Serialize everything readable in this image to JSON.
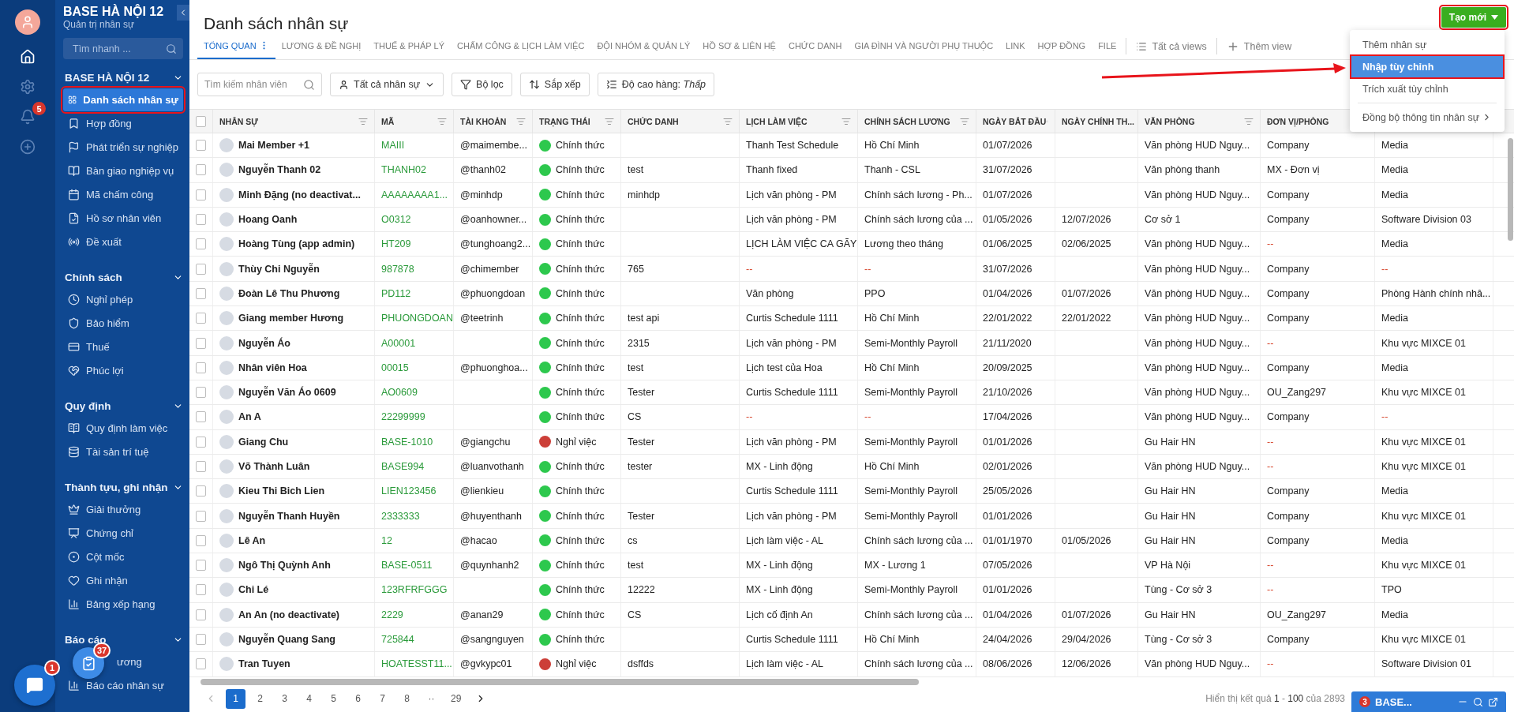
{
  "sidebar": {
    "org_name": "BASE HÀ NỘI 12",
    "org_subtitle": "Quản trị nhân sự",
    "search": {
      "placeholder": "Tìm nhanh ..."
    },
    "notifications_badge": "5",
    "sections": [
      {
        "title": "BASE HÀ NỘI 12",
        "expanded": true,
        "items": [
          {
            "label": "Danh sách nhân sự",
            "selected": true
          },
          {
            "label": "Hợp đồng",
            "selected": false
          },
          {
            "label": "Phát triển sự nghiệp",
            "selected": false
          },
          {
            "label": "Bàn giao nghiệp vụ",
            "selected": false
          },
          {
            "label": "Mã chấm công",
            "selected": false
          },
          {
            "label": "Hồ sơ nhân viên",
            "selected": false
          },
          {
            "label": "Đề xuất",
            "selected": false
          }
        ]
      },
      {
        "title": "Chính sách",
        "expanded": true,
        "items": [
          {
            "label": "Nghỉ phép",
            "selected": false
          },
          {
            "label": "Bảo hiểm",
            "selected": false
          },
          {
            "label": "Thuế",
            "selected": false
          },
          {
            "label": "Phúc lợi",
            "selected": false
          }
        ]
      },
      {
        "title": "Quy định",
        "expanded": true,
        "items": [
          {
            "label": "Quy định làm việc",
            "selected": false
          },
          {
            "label": "Tài sản trí tuệ",
            "selected": false
          }
        ]
      },
      {
        "title": "Thành tựu, ghi nhận",
        "expanded": true,
        "items": [
          {
            "label": "Giải thưởng",
            "selected": false
          },
          {
            "label": "Chứng chỉ",
            "selected": false
          },
          {
            "label": "Cột mốc",
            "selected": false
          },
          {
            "label": "Ghi nhận",
            "selected": false
          },
          {
            "label": "Bảng xếp hạng",
            "selected": false
          }
        ]
      },
      {
        "title": "Báo cáo",
        "expanded": true,
        "items": [
          {
            "label": "ương",
            "selected": false
          },
          {
            "label": "Báo cáo nhân sự",
            "selected": false
          }
        ]
      }
    ]
  },
  "floating": {
    "chat_badge": "1",
    "tasks_badge": "37"
  },
  "page": {
    "title": "Danh sách nhân sự",
    "create_button": "Tạo mới"
  },
  "tabs": [
    {
      "label": "TỔNG QUAN",
      "selected": true
    },
    {
      "label": "LƯƠNG & ĐỀ NGHỊ",
      "selected": false
    },
    {
      "label": "THUẾ & PHÁP LÝ",
      "selected": false
    },
    {
      "label": "CHẤM CÔNG & LỊCH LÀM VIỆC",
      "selected": false
    },
    {
      "label": "ĐỘI NHÓM & QUẢN LÝ",
      "selected": false
    },
    {
      "label": "HỒ SƠ & LIÊN HỆ",
      "selected": false
    },
    {
      "label": "CHỨC DANH",
      "selected": false
    },
    {
      "label": "GIA ĐÌNH VÀ NGƯỜI PHỤ THUỘC",
      "selected": false
    },
    {
      "label": "LINK",
      "selected": false
    },
    {
      "label": "HỢP ĐỒNG",
      "selected": false
    },
    {
      "label": "FILE",
      "selected": false
    }
  ],
  "view_actions": {
    "all_views": "Tất cả views",
    "add_view": "Thêm view"
  },
  "toolbar": {
    "search": {
      "placeholder": "Tìm kiếm nhân viên"
    },
    "scope": "Tất cả nhân sự",
    "filter": "Bộ lọc",
    "sort": "Sắp xếp",
    "row_height": "Độ cao hàng: *Thấp*"
  },
  "create_menu": {
    "items": [
      {
        "label": "Thêm nhân sự",
        "selected": false
      },
      {
        "label": "Nhập tùy chỉnh",
        "selected": true
      },
      {
        "label": "Trích xuất tùy chỉnh",
        "selected": false
      },
      {
        "label": "Đồng bộ thông tin nhân sự",
        "selected": false
      }
    ]
  },
  "table": {
    "select_all_checked": false,
    "columns": [
      "NHÂN SỰ",
      "MÃ",
      "TÀI KHOẢN",
      "TRẠNG THÁI",
      "CHỨC DANH",
      "LỊCH LÀM VIỆC",
      "CHÍNH SÁCH LƯƠNG",
      "NGÀY BẮT ĐẦU",
      "NGÀY CHÍNH TH...",
      "VĂN PHÒNG",
      "ĐƠN VỊ/PHÒNG"
    ],
    "rows": [
      {
        "checked": false,
        "cells": [
          "Mai Member +1",
          "MAIII",
          "@maimembe...",
          {
            "text": "Chính thức",
            "color": "#2dc84d"
          },
          "",
          "Thanh Test Schedule",
          "Hồ Chí Minh",
          "01/07/2026",
          "",
          "Văn phòng HUD Nguy...",
          "Company",
          "Media"
        ]
      },
      {
        "checked": false,
        "cells": [
          "Nguyễn Thanh 02",
          "THANH02",
          "@thanh02",
          {
            "text": "Chính thức",
            "color": "#2dc84d"
          },
          "test",
          "Thanh fixed",
          "Thanh - CSL",
          "31/07/2026",
          "",
          "Văn phòng thanh",
          "MX - Đơn vị",
          "Media"
        ]
      },
      {
        "checked": false,
        "cells": [
          "Minh Đặng (no deactivat...",
          "AAAAAAAA1...",
          "@minhdp",
          {
            "text": "Chính thức",
            "color": "#2dc84d"
          },
          "minhdp",
          "Lịch văn phòng - PM",
          "Chính sách lương - Ph...",
          "01/07/2026",
          "",
          "Văn phòng HUD Nguy...",
          "Company",
          "Media"
        ]
      },
      {
        "checked": false,
        "cells": [
          "Hoang Oanh",
          "O0312",
          "@oanhowner...",
          {
            "text": "Chính thức",
            "color": "#2dc84d"
          },
          "",
          "Lịch văn phòng - PM",
          "Chính sách lương của ...",
          "01/05/2026",
          "12/07/2026",
          "Cơ sở 1",
          "Company",
          "Software Division 03"
        ]
      },
      {
        "checked": false,
        "cells": [
          "Hoàng Tùng (app admin)",
          "HT209",
          "@tunghoang2...",
          {
            "text": "Chính thức",
            "color": "#2dc84d"
          },
          "",
          "LỊCH LÀM VIỆC CA GÃY",
          "Lương theo tháng",
          "01/06/2025",
          "02/06/2025",
          "Văn phòng HUD Nguy...",
          {
            "text": "--",
            "kind": "dash"
          },
          "Media"
        ]
      },
      {
        "checked": false,
        "cells": [
          "Thùy Chi Nguyễn",
          "987878",
          "@chimember",
          {
            "text": "Chính thức",
            "color": "#2dc84d"
          },
          "765",
          {
            "text": "--",
            "kind": "dash"
          },
          {
            "text": "--",
            "kind": "dash"
          },
          "31/07/2026",
          "",
          "Văn phòng HUD Nguy...",
          "Company",
          {
            "text": "--",
            "kind": "dash"
          }
        ]
      },
      {
        "checked": false,
        "cells": [
          "Đoàn Lê Thu Phương",
          "PD112",
          "@phuongdoan",
          {
            "text": "Chính thức",
            "color": "#2dc84d"
          },
          "",
          "Văn phòng",
          "PPO",
          "01/04/2026",
          "01/07/2026",
          "Văn phòng HUD Nguy...",
          "Company",
          "Phòng Hành chính nhâ..."
        ]
      },
      {
        "checked": false,
        "cells": [
          "Giang member Hương",
          "PHUONGDOAN",
          "@teetrinh",
          {
            "text": "Chính thức",
            "color": "#2dc84d"
          },
          "test api",
          "Curtis Schedule 1111",
          "Hồ Chí Minh",
          "22/01/2022",
          "22/01/2022",
          "Văn phòng HUD Nguy...",
          "Company",
          "Media"
        ]
      },
      {
        "checked": false,
        "cells": [
          "Nguyễn Áo",
          "A00001",
          "",
          {
            "text": "Chính thức",
            "color": "#2dc84d"
          },
          "2315",
          "Lịch văn phòng - PM",
          "Semi-Monthly Payroll",
          "21/11/2020",
          "",
          "Văn phòng HUD Nguy...",
          {
            "text": "--",
            "kind": "dash"
          },
          "Khu vực MIXCE 01"
        ]
      },
      {
        "checked": false,
        "cells": [
          "Nhân viên Hoa",
          "00015",
          "@phuonghoa...",
          {
            "text": "Chính thức",
            "color": "#2dc84d"
          },
          "test",
          "Lịch test của Hoa",
          "Hồ Chí Minh",
          "20/09/2025",
          "",
          "Văn phòng HUD Nguy...",
          "Company",
          "Media"
        ]
      },
      {
        "checked": false,
        "cells": [
          "Nguyễn Văn Áo 0609",
          "AO0609",
          "",
          {
            "text": "Chính thức",
            "color": "#2dc84d"
          },
          "Tester",
          "Curtis Schedule 1111",
          "Semi-Monthly Payroll",
          "21/10/2026",
          "",
          "Văn phòng HUD Nguy...",
          "OU_Zang297",
          "Khu vực MIXCE 01"
        ]
      },
      {
        "checked": false,
        "cells": [
          "An A",
          "22299999",
          "",
          {
            "text": "Chính thức",
            "color": "#2dc84d"
          },
          "CS",
          {
            "text": "--",
            "kind": "dash"
          },
          {
            "text": "--",
            "kind": "dash"
          },
          "17/04/2026",
          "",
          "Văn phòng HUD Nguy...",
          "Company",
          {
            "text": "--",
            "kind": "dash"
          }
        ]
      },
      {
        "checked": false,
        "cells": [
          "Giang Chu",
          "BASE-1010",
          "@giangchu",
          {
            "text": "Nghỉ việc",
            "color": "#cc3f38"
          },
          "Tester",
          "Lịch văn phòng - PM",
          "Semi-Monthly Payroll",
          "01/01/2026",
          "",
          "Gu Hair HN",
          {
            "text": "--",
            "kind": "dash"
          },
          "Khu vực MIXCE 01"
        ]
      },
      {
        "checked": false,
        "cells": [
          "Võ Thành Luân",
          "BASE994",
          "@luanvothanh",
          {
            "text": "Chính thức",
            "color": "#2dc84d"
          },
          "tester",
          "MX - Linh động",
          "Hồ Chí Minh",
          "02/01/2026",
          "",
          "Văn phòng HUD Nguy...",
          {
            "text": "--",
            "kind": "dash"
          },
          "Khu vực MIXCE 01"
        ]
      },
      {
        "checked": false,
        "cells": [
          "Kieu Thi Bich Lien",
          "LIEN123456",
          "@lienkieu",
          {
            "text": "Chính thức",
            "color": "#2dc84d"
          },
          "",
          "Curtis Schedule 1111",
          "Semi-Monthly Payroll",
          "25/05/2026",
          "",
          "Gu Hair HN",
          "Company",
          "Media"
        ]
      },
      {
        "checked": false,
        "cells": [
          "Nguyễn Thanh Huyền",
          "2333333",
          "@huyenthanh",
          {
            "text": "Chính thức",
            "color": "#2dc84d"
          },
          "Tester",
          "Lịch văn phòng - PM",
          "Semi-Monthly Payroll",
          "01/01/2026",
          "",
          "Gu Hair HN",
          "Company",
          "Khu vực MIXCE 01"
        ]
      },
      {
        "checked": false,
        "cells": [
          "Lê An",
          "12",
          "@hacao",
          {
            "text": "Chính thức",
            "color": "#2dc84d"
          },
          "cs",
          "Lịch làm việc - AL",
          "Chính sách lương của ...",
          "01/01/1970",
          "01/05/2026",
          "Gu Hair HN",
          "Company",
          "Media"
        ]
      },
      {
        "checked": false,
        "cells": [
          "Ngô Thị Quỳnh Anh",
          "BASE-0511",
          "@quynhanh2",
          {
            "text": "Chính thức",
            "color": "#2dc84d"
          },
          "test",
          "MX - Linh động",
          "MX - Lương 1",
          "07/05/2026",
          "",
          "VP Hà Nội",
          {
            "text": "--",
            "kind": "dash"
          },
          "Khu vực MIXCE 01"
        ]
      },
      {
        "checked": false,
        "cells": [
          "Chi Lé",
          "123RFRFGGG",
          "",
          {
            "text": "Chính thức",
            "color": "#2dc84d"
          },
          "12222",
          "MX - Linh động",
          "Semi-Monthly Payroll",
          "01/01/2026",
          "",
          "Tùng - Cơ sở 3",
          {
            "text": "--",
            "kind": "dash"
          },
          "TPO"
        ]
      },
      {
        "checked": false,
        "cells": [
          "An An (no deactivate)",
          "2229",
          "@anan29",
          {
            "text": "Chính thức",
            "color": "#2dc84d"
          },
          "CS",
          "Lịch cố định An",
          "Chính sách lương của ...",
          "01/04/2026",
          "01/07/2026",
          "Gu Hair HN",
          "OU_Zang297",
          "Media"
        ]
      },
      {
        "checked": false,
        "cells": [
          "Nguyễn Quang Sang",
          "725844",
          "@sangnguyen",
          {
            "text": "Chính thức",
            "color": "#2dc84d"
          },
          "",
          "Curtis Schedule 1111",
          "Hồ Chí Minh",
          "24/04/2026",
          "29/04/2026",
          "Tùng - Cơ sở 3",
          "Company",
          "Khu vực MIXCE 01"
        ]
      },
      {
        "checked": false,
        "cells": [
          "Tran Tuyen",
          "HOATESST11...",
          "@gvkypc01",
          {
            "text": "Nghỉ việc",
            "color": "#cc3f38"
          },
          "dsffds",
          "Lịch làm việc - AL",
          "Chính sách lương của ...",
          "08/06/2026",
          "12/06/2026",
          "Văn phòng HUD Nguy...",
          {
            "text": "--",
            "kind": "dash"
          },
          "Software Division 01"
        ]
      }
    ]
  },
  "pagination": {
    "pages": [
      {
        "label": "1",
        "selected": true
      },
      {
        "label": "2",
        "selected": false
      },
      {
        "label": "3",
        "selected": false
      },
      {
        "label": "4",
        "selected": false
      },
      {
        "label": "5",
        "selected": false
      },
      {
        "label": "6",
        "selected": false
      },
      {
        "label": "7",
        "selected": false
      },
      {
        "label": "8",
        "selected": false
      },
      {
        "label": "··",
        "selected": false
      },
      {
        "label": "29",
        "selected": false
      }
    ],
    "summary": "Hiển thị kết quả **1** - **100** của 2893"
  },
  "chat_widget": {
    "badge": "3",
    "title": "BASE..."
  }
}
